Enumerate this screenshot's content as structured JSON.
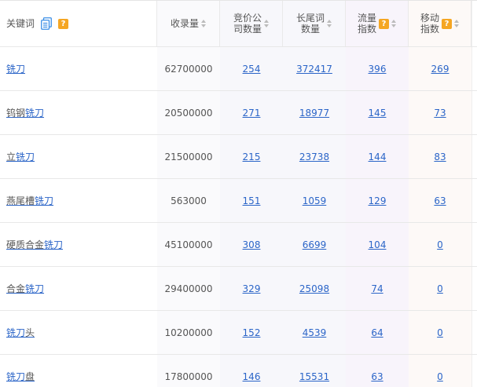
{
  "columns": {
    "keyword": "关键词",
    "volume": "收录量",
    "bid_line1": "竞价公",
    "bid_line2": "司数量",
    "long_line1": "长尾词",
    "long_line2": "数量",
    "flow_line1": "流量",
    "flow_line2": "指数",
    "mobile_line1": "移动",
    "mobile_line2": "指数",
    "help_glyph": "?"
  },
  "colors": {
    "link": "#2b65c8",
    "help_badge": "#f5a623",
    "copy_icon": "#3a8ee6",
    "keyword_col_bg": "#ffffff",
    "mid_col_bg": "#f7f7fb",
    "flow_col_bg": "#f7f3fb",
    "mobile_col_bg": "#fdf8f6"
  },
  "rows": [
    {
      "prefix": "",
      "link": "铣刀",
      "suffix": "",
      "volume": "62700000",
      "bid": "254",
      "long": "372417",
      "flow": "396",
      "mobile": "269"
    },
    {
      "prefix": "钨钢",
      "link": "铣刀",
      "suffix": "",
      "volume": "20500000",
      "bid": "271",
      "long": "18977",
      "flow": "145",
      "mobile": "73"
    },
    {
      "prefix": "立",
      "link": "铣刀",
      "suffix": "",
      "volume": "21500000",
      "bid": "215",
      "long": "23738",
      "flow": "144",
      "mobile": "83"
    },
    {
      "prefix": "燕尾槽",
      "link": "铣刀",
      "suffix": "",
      "volume": "563000",
      "bid": "151",
      "long": "1059",
      "flow": "129",
      "mobile": "63"
    },
    {
      "prefix": "硬质合金",
      "link": "铣刀",
      "suffix": "",
      "volume": "45100000",
      "bid": "308",
      "long": "6699",
      "flow": "104",
      "mobile": "0"
    },
    {
      "prefix": "合金",
      "link": "铣刀",
      "suffix": "",
      "volume": "29400000",
      "bid": "329",
      "long": "25098",
      "flow": "74",
      "mobile": "0"
    },
    {
      "prefix": "",
      "link": "铣刀",
      "suffix": "头",
      "volume": "10200000",
      "bid": "152",
      "long": "4539",
      "flow": "64",
      "mobile": "0"
    },
    {
      "prefix": "",
      "link": "铣刀",
      "suffix": "盘",
      "volume": "17800000",
      "bid": "146",
      "long": "15531",
      "flow": "63",
      "mobile": "0"
    }
  ]
}
